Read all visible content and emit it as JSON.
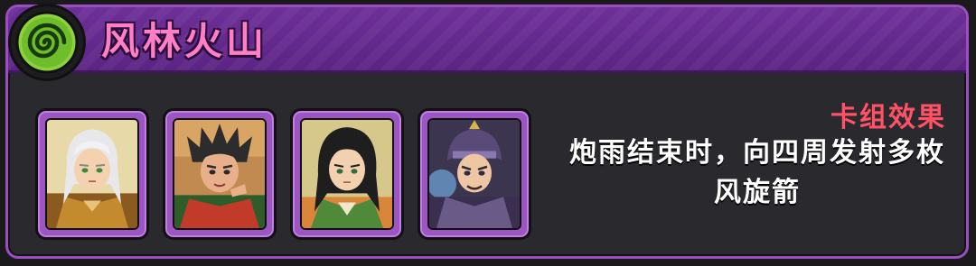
{
  "panel": {
    "title": "风林火山",
    "emblem_icon": "green-spiral-icon",
    "accent_color": "#9a4ec0",
    "title_color": "#ff7fc6"
  },
  "cards": [
    {
      "character": "white-haired-elder-portrait",
      "frame_color": "#9b56c2"
    },
    {
      "character": "spiky-haired-warrior-portrait",
      "frame_color": "#9b56c2"
    },
    {
      "character": "long-haired-strategist-portrait",
      "frame_color": "#9b56c2"
    },
    {
      "character": "armored-general-portrait",
      "frame_color": "#9b56c2"
    }
  ],
  "effect": {
    "label": "卡组效果",
    "line1": "炮雨结束时，向四周发射多枚",
    "line2": "风旋箭",
    "label_color": "#ff5266"
  }
}
